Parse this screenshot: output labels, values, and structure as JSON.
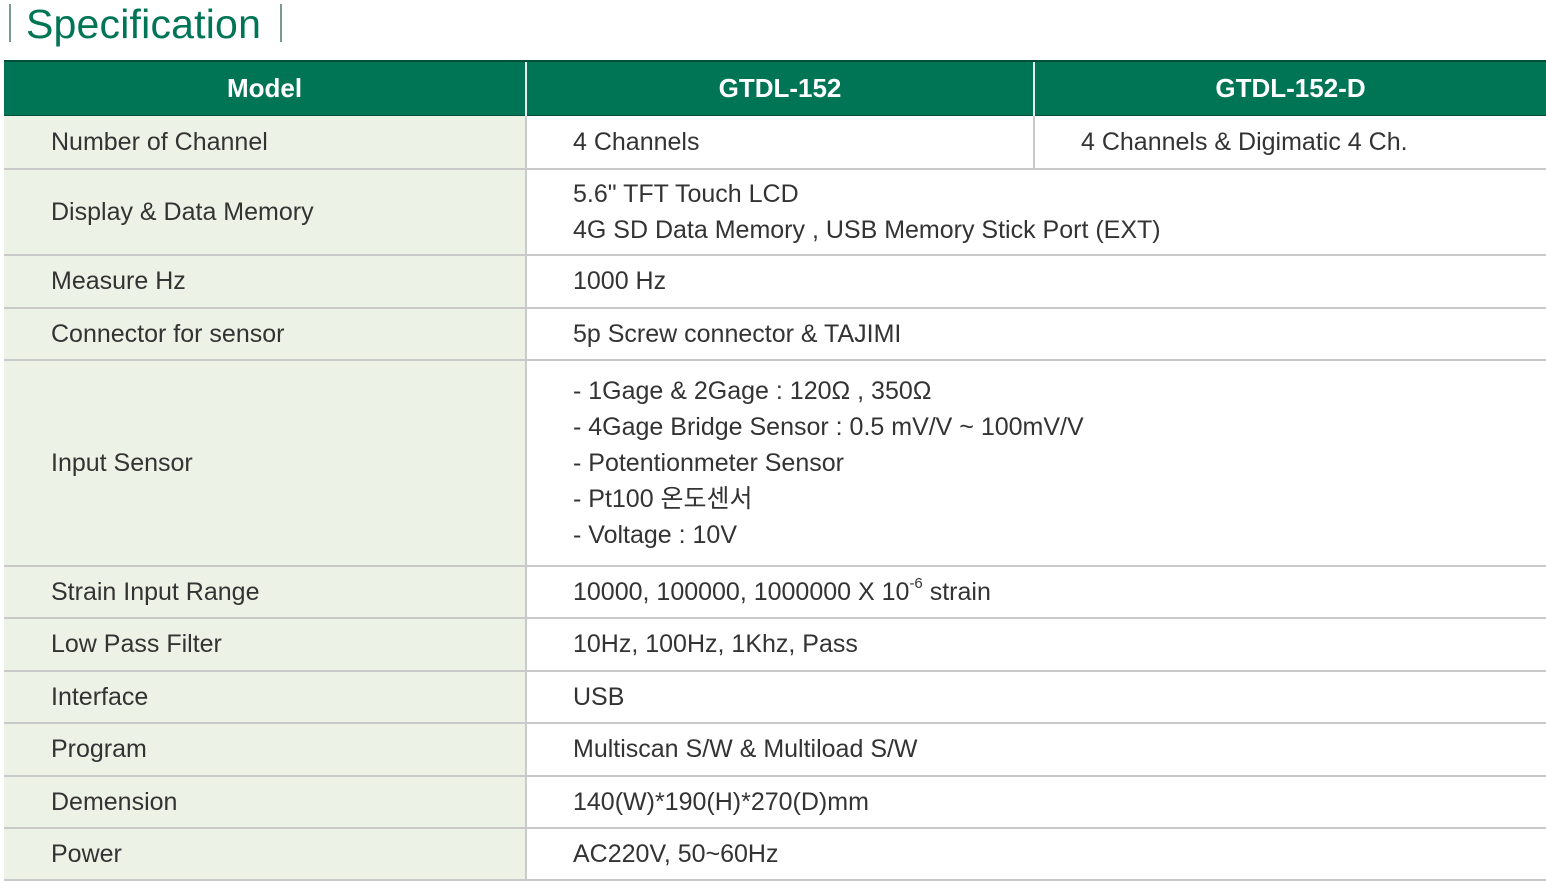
{
  "title": "Specification",
  "header": {
    "col1": "Model",
    "col2": "GTDL-152",
    "col3": "GTDL-152-D"
  },
  "rows": {
    "channel": {
      "label": "Number of Channel",
      "val1": "4 Channels",
      "val2": "4 Channels & Digimatic 4 Ch."
    },
    "display": {
      "label": "Display & Data Memory",
      "lines": [
        "5.6\" TFT Touch LCD",
        "4G SD Data Memory , USB Memory Stick Port (EXT)"
      ]
    },
    "hz": {
      "label": "Measure Hz",
      "value": "1000 Hz"
    },
    "connector": {
      "label": "Connector for sensor",
      "value": "5p Screw connector & TAJIMI"
    },
    "input": {
      "label": "Input Sensor",
      "lines": [
        "- 1Gage & 2Gage : 120Ω , 350Ω",
        "- 4Gage Bridge Sensor : 0.5 mV/V ~ 100mV/V",
        "- Potentionmeter Sensor",
        "- Pt100 온도센서",
        "- Voltage : 10V"
      ]
    },
    "strain": {
      "label": "Strain Input Range",
      "value_pre": "10000, 100000, 1000000 X 10",
      "value_sup": "-6",
      "value_post": " strain"
    },
    "lpf": {
      "label": "Low Pass Filter",
      "value": "10Hz, 100Hz, 1Khz, Pass"
    },
    "interface": {
      "label": "Interface",
      "value": "USB"
    },
    "program": {
      "label": "Program",
      "value": "Multiscan S/W & Multiload S/W"
    },
    "dimension": {
      "label": "Demension",
      "value": "140(W)*190(H)*270(D)mm"
    },
    "power": {
      "label": "Power",
      "value": "AC220V, 50~60Hz"
    }
  },
  "colors": {
    "header_bg": "#007556",
    "label_bg": "#edf2e6",
    "title": "#007556"
  }
}
